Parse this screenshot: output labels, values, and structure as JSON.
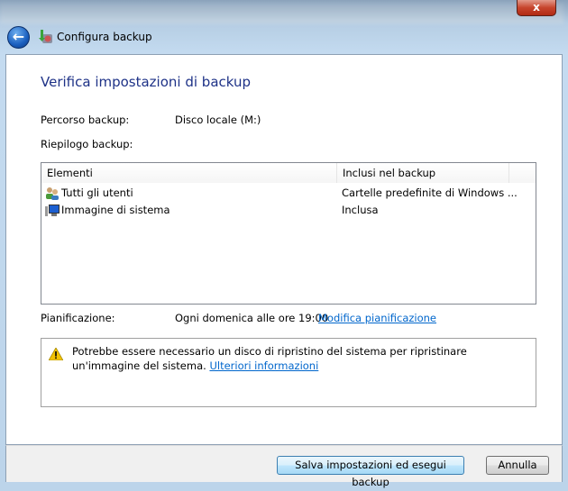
{
  "window": {
    "title": "Configura backup",
    "close_label": "x"
  },
  "page": {
    "heading": "Verifica impostazioni di backup",
    "backup_path_label": "Percorso backup:",
    "backup_path_value": "Disco locale (M:)",
    "summary_label": "Riepilogo backup:",
    "table": {
      "columns": [
        "Elementi",
        "Inclusi nel backup"
      ],
      "rows": [
        {
          "name": "Tutti gli utenti",
          "included": "Cartelle predefinite di Windows ...",
          "icon": "users-icon"
        },
        {
          "name": "Immagine di sistema",
          "included": "Inclusa",
          "icon": "computer-icon"
        }
      ]
    },
    "schedule_label": "Pianificazione:",
    "schedule_value": "Ogni domenica alle ore 19:00",
    "schedule_link": "Modifica pianificazione",
    "warning_text": "Potrebbe essere necessario un disco di ripristino del sistema per ripristinare un'immagine del sistema.",
    "warning_link": "Ulteriori informazioni"
  },
  "footer": {
    "save_label": "Salva impostazioni ed esegui backup",
    "cancel_label": "Annulla"
  }
}
